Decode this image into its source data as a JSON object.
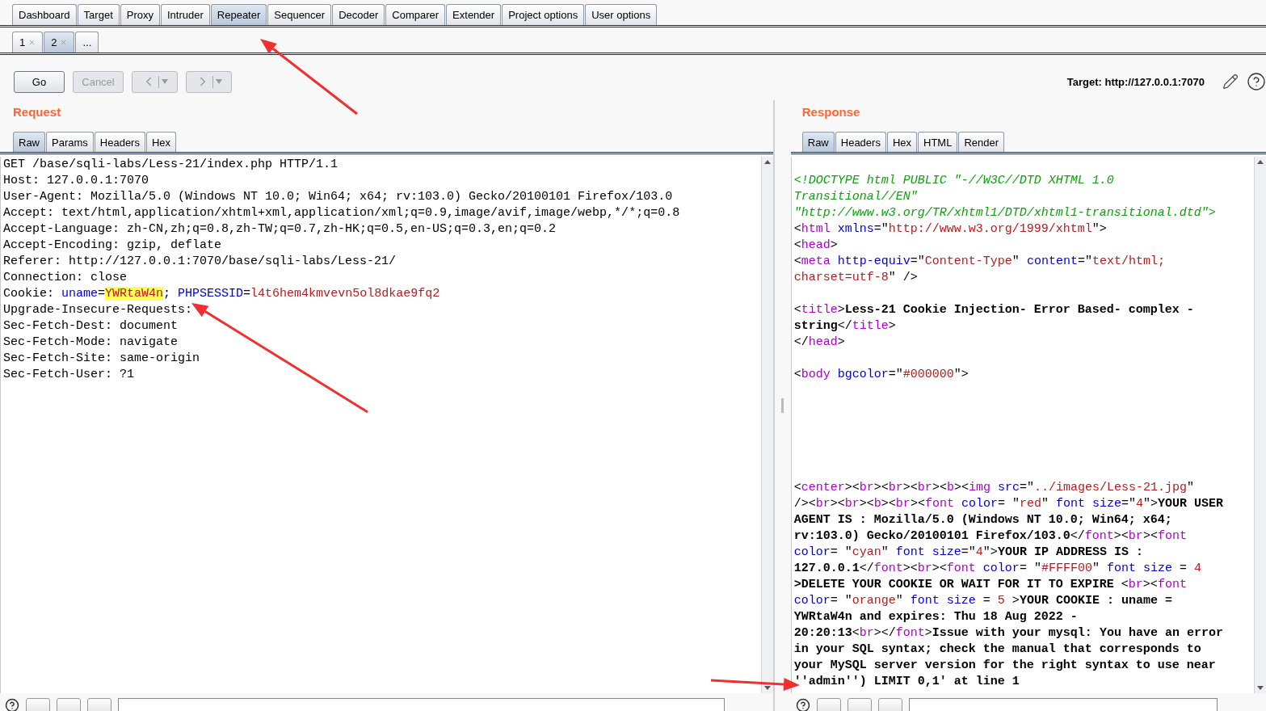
{
  "main_tabs": [
    {
      "label": "Dashboard",
      "selected": false
    },
    {
      "label": "Target",
      "selected": false
    },
    {
      "label": "Proxy",
      "selected": false
    },
    {
      "label": "Intruder",
      "selected": false
    },
    {
      "label": "Repeater",
      "selected": true
    },
    {
      "label": "Sequencer",
      "selected": false
    },
    {
      "label": "Decoder",
      "selected": false
    },
    {
      "label": "Comparer",
      "selected": false
    },
    {
      "label": "Extender",
      "selected": false
    },
    {
      "label": "Project options",
      "selected": false
    },
    {
      "label": "User options",
      "selected": false
    }
  ],
  "repeater_tabs": [
    {
      "label": "1",
      "closable": true,
      "selected": false
    },
    {
      "label": "2",
      "closable": true,
      "selected": true
    },
    {
      "label": "...",
      "closable": false,
      "selected": false
    }
  ],
  "toolbar": {
    "buttons": [
      {
        "kind": "text",
        "label": "Go",
        "disabled": false
      },
      {
        "kind": "text",
        "label": "Cancel",
        "disabled": true
      },
      {
        "kind": "back",
        "disabled": true
      },
      {
        "kind": "forward",
        "disabled": true
      }
    ],
    "target": "Target: http://127.0.0.1:7070"
  },
  "request": {
    "title": "Request",
    "tabs": [
      {
        "label": "Raw",
        "selected": true
      },
      {
        "label": "Params",
        "selected": false
      },
      {
        "label": "Headers",
        "selected": false
      },
      {
        "label": "Hex",
        "selected": false
      }
    ],
    "lines": [
      {
        "kind": "code",
        "spans": [
          {
            "kind": "plain",
            "text": "GET /base/sqli-labs/Less-21/index.php HTTP/1.1"
          }
        ]
      },
      {
        "kind": "code",
        "spans": [
          {
            "kind": "plain",
            "text": "Host: 127.0.0.1:7070"
          }
        ]
      },
      {
        "kind": "code",
        "spans": [
          {
            "kind": "plain",
            "text": "User-Agent: Mozilla/5.0 (Windows NT 10.0; Win64; x64; rv:103.0) Gecko/20100101 Firefox/103.0"
          }
        ]
      },
      {
        "kind": "code",
        "spans": [
          {
            "kind": "plain",
            "text": "Accept: text/html,application/xhtml+xml,application/xml;q=0.9,image/avif,image/webp,*/*;q=0.8"
          }
        ]
      },
      {
        "kind": "code",
        "spans": [
          {
            "kind": "plain",
            "text": "Accept-Language: zh-CN,zh;q=0.8,zh-TW;q=0.7,zh-HK;q=0.5,en-US;q=0.3,en;q=0.2"
          }
        ]
      },
      {
        "kind": "code",
        "spans": [
          {
            "kind": "plain",
            "text": "Accept-Encoding: gzip, deflate"
          }
        ]
      },
      {
        "kind": "code",
        "spans": [
          {
            "kind": "plain",
            "text": "Referer: http://127.0.0.1:7070/base/sqli-labs/Less-21/"
          }
        ]
      },
      {
        "kind": "code",
        "spans": [
          {
            "kind": "plain",
            "text": "Connection: close"
          }
        ]
      },
      {
        "kind": "code",
        "spans": [
          {
            "kind": "plain",
            "text": "Cookie: "
          },
          {
            "kind": "attr",
            "text": "uname"
          },
          {
            "kind": "plain",
            "text": "="
          },
          {
            "kind": "highlight",
            "text": "YWRtaW4n"
          },
          {
            "kind": "plain",
            "text": "; "
          },
          {
            "kind": "attr",
            "text": "PHPSESSID"
          },
          {
            "kind": "plain",
            "text": "="
          },
          {
            "kind": "val",
            "text": "l4t6hem4kmvevn5ol8dkae9fq2"
          }
        ]
      },
      {
        "kind": "code",
        "spans": [
          {
            "kind": "plain",
            "text": "Upgrade-Insecure-Requests:"
          }
        ]
      },
      {
        "kind": "code",
        "spans": [
          {
            "kind": "plain",
            "text": "Sec-Fetch-Dest: document"
          }
        ]
      },
      {
        "kind": "code",
        "spans": [
          {
            "kind": "plain",
            "text": "Sec-Fetch-Mode: navigate"
          }
        ]
      },
      {
        "kind": "code",
        "spans": [
          {
            "kind": "plain",
            "text": "Sec-Fetch-Site: same-origin"
          }
        ]
      },
      {
        "kind": "code",
        "spans": [
          {
            "kind": "plain",
            "text": "Sec-Fetch-User: ?1"
          }
        ]
      }
    ]
  },
  "response": {
    "title": "Response",
    "tabs": [
      {
        "label": "Raw",
        "selected": true
      },
      {
        "label": "Headers",
        "selected": false
      },
      {
        "label": "Hex",
        "selected": false
      },
      {
        "label": "HTML",
        "selected": false
      },
      {
        "label": "Render",
        "selected": false
      }
    ],
    "lines": [
      {
        "kind": "code",
        "spans": [
          {
            "kind": "comment",
            "text": "<!DOCTYPE html PUBLIC \"-//W3C//DTD XHTML 1.0"
          }
        ]
      },
      {
        "kind": "code",
        "spans": [
          {
            "kind": "comment",
            "text": "Transitional//EN\""
          }
        ]
      },
      {
        "kind": "code",
        "spans": [
          {
            "kind": "comment",
            "text": "\"http://www.w3.org/TR/xhtml1/DTD/xhtml1-transitional.dtd\">"
          }
        ]
      },
      {
        "kind": "code",
        "spans": [
          {
            "kind": "plain",
            "text": "<"
          },
          {
            "kind": "tag",
            "text": "html"
          },
          {
            "kind": "attr",
            "text": " xmlns"
          },
          {
            "kind": "plain",
            "text": "=\""
          },
          {
            "kind": "val",
            "text": "http://www.w3.org/1999/xhtml"
          },
          {
            "kind": "plain",
            "text": "\">"
          }
        ]
      },
      {
        "kind": "code",
        "spans": [
          {
            "kind": "plain",
            "text": "<"
          },
          {
            "kind": "tag",
            "text": "head"
          },
          {
            "kind": "plain",
            "text": ">"
          }
        ]
      },
      {
        "kind": "code",
        "spans": [
          {
            "kind": "plain",
            "text": "<"
          },
          {
            "kind": "tag",
            "text": "meta"
          },
          {
            "kind": "attr",
            "text": " http-equiv"
          },
          {
            "kind": "plain",
            "text": "=\""
          },
          {
            "kind": "val",
            "text": "Content-Type"
          },
          {
            "kind": "plain",
            "text": "\" "
          },
          {
            "kind": "attr",
            "text": "content"
          },
          {
            "kind": "plain",
            "text": "=\""
          },
          {
            "kind": "val",
            "text": "text/html;"
          }
        ]
      },
      {
        "kind": "code",
        "spans": [
          {
            "kind": "val",
            "text": "charset=utf-8"
          },
          {
            "kind": "plain",
            "text": "\" />"
          }
        ]
      },
      {
        "kind": "blank"
      },
      {
        "kind": "code",
        "spans": [
          {
            "kind": "plain",
            "text": "<"
          },
          {
            "kind": "tag",
            "text": "title"
          },
          {
            "kind": "plain",
            "text": ">"
          },
          {
            "kind": "bold",
            "text": "Less-21 Cookie Injection- Error Based- complex -"
          }
        ]
      },
      {
        "kind": "code",
        "spans": [
          {
            "kind": "bold",
            "text": "string"
          },
          {
            "kind": "plain",
            "text": "</"
          },
          {
            "kind": "tag",
            "text": "title"
          },
          {
            "kind": "plain",
            "text": ">"
          }
        ]
      },
      {
        "kind": "code",
        "spans": [
          {
            "kind": "plain",
            "text": "</"
          },
          {
            "kind": "tag",
            "text": "head"
          },
          {
            "kind": "plain",
            "text": ">"
          }
        ]
      },
      {
        "kind": "blank"
      },
      {
        "kind": "code",
        "spans": [
          {
            "kind": "plain",
            "text": "<"
          },
          {
            "kind": "tag",
            "text": "body"
          },
          {
            "kind": "attr",
            "text": " bgcolor"
          },
          {
            "kind": "plain",
            "text": "=\""
          },
          {
            "kind": "val",
            "text": "#000000"
          },
          {
            "kind": "plain",
            "text": "\">"
          }
        ]
      },
      {
        "kind": "blank"
      },
      {
        "kind": "blank"
      },
      {
        "kind": "blank"
      },
      {
        "kind": "blank"
      },
      {
        "kind": "blank"
      },
      {
        "kind": "blank"
      },
      {
        "kind": "code",
        "spans": [
          {
            "kind": "plain",
            "text": "<"
          },
          {
            "kind": "tag",
            "text": "center"
          },
          {
            "kind": "plain",
            "text": "><"
          },
          {
            "kind": "tag",
            "text": "br"
          },
          {
            "kind": "plain",
            "text": "><"
          },
          {
            "kind": "tag",
            "text": "br"
          },
          {
            "kind": "plain",
            "text": "><"
          },
          {
            "kind": "tag",
            "text": "br"
          },
          {
            "kind": "plain",
            "text": "><"
          },
          {
            "kind": "tag",
            "text": "b"
          },
          {
            "kind": "plain",
            "text": "><"
          },
          {
            "kind": "tag",
            "text": "img"
          },
          {
            "kind": "attr",
            "text": " src"
          },
          {
            "kind": "plain",
            "text": "=\""
          },
          {
            "kind": "val",
            "text": "../images/Less-21.jpg"
          },
          {
            "kind": "plain",
            "text": "\""
          }
        ]
      },
      {
        "kind": "code",
        "spans": [
          {
            "kind": "plain",
            "text": "/><"
          },
          {
            "kind": "tag",
            "text": "br"
          },
          {
            "kind": "plain",
            "text": "><"
          },
          {
            "kind": "tag",
            "text": "br"
          },
          {
            "kind": "plain",
            "text": "><"
          },
          {
            "kind": "tag",
            "text": "b"
          },
          {
            "kind": "plain",
            "text": "><"
          },
          {
            "kind": "tag",
            "text": "br"
          },
          {
            "kind": "plain",
            "text": "><"
          },
          {
            "kind": "tag",
            "text": "font"
          },
          {
            "kind": "attr",
            "text": " color"
          },
          {
            "kind": "plain",
            "text": "= \""
          },
          {
            "kind": "val",
            "text": "red"
          },
          {
            "kind": "plain",
            "text": "\" "
          },
          {
            "kind": "attr",
            "text": "font size"
          },
          {
            "kind": "plain",
            "text": "=\""
          },
          {
            "kind": "val",
            "text": "4"
          },
          {
            "kind": "plain",
            "text": "\">"
          },
          {
            "kind": "bold",
            "text": "YOUR USER"
          }
        ]
      },
      {
        "kind": "code",
        "spans": [
          {
            "kind": "bold",
            "text": "AGENT IS : Mozilla/5.0 (Windows NT 10.0; Win64; x64;"
          }
        ]
      },
      {
        "kind": "code",
        "spans": [
          {
            "kind": "bold",
            "text": "rv:103.0) Gecko/20100101 Firefox/103.0"
          },
          {
            "kind": "plain",
            "text": "</"
          },
          {
            "kind": "tag",
            "text": "font"
          },
          {
            "kind": "plain",
            "text": "><"
          },
          {
            "kind": "tag",
            "text": "br"
          },
          {
            "kind": "plain",
            "text": "><"
          },
          {
            "kind": "tag",
            "text": "font"
          }
        ]
      },
      {
        "kind": "code",
        "spans": [
          {
            "kind": "attr",
            "text": "color"
          },
          {
            "kind": "plain",
            "text": "= \""
          },
          {
            "kind": "val",
            "text": "cyan"
          },
          {
            "kind": "plain",
            "text": "\" "
          },
          {
            "kind": "attr",
            "text": "font size"
          },
          {
            "kind": "plain",
            "text": "=\""
          },
          {
            "kind": "val",
            "text": "4"
          },
          {
            "kind": "plain",
            "text": "\">"
          },
          {
            "kind": "bold",
            "text": "YOUR IP ADDRESS IS :"
          }
        ]
      },
      {
        "kind": "code",
        "spans": [
          {
            "kind": "bold",
            "text": "127.0.0.1"
          },
          {
            "kind": "plain",
            "text": "</"
          },
          {
            "kind": "tag",
            "text": "font"
          },
          {
            "kind": "plain",
            "text": "><"
          },
          {
            "kind": "tag",
            "text": "br"
          },
          {
            "kind": "plain",
            "text": "><"
          },
          {
            "kind": "tag",
            "text": "font"
          },
          {
            "kind": "attr",
            "text": " color"
          },
          {
            "kind": "plain",
            "text": "= \""
          },
          {
            "kind": "val",
            "text": "#FFFF00"
          },
          {
            "kind": "plain",
            "text": "\" "
          },
          {
            "kind": "attr",
            "text": "font size"
          },
          {
            "kind": "plain",
            "text": " = "
          },
          {
            "kind": "val",
            "text": "4"
          }
        ]
      },
      {
        "kind": "code",
        "spans": [
          {
            "kind": "bold",
            "text": ">DELETE YOUR COOKIE OR WAIT FOR IT TO EXPIRE "
          },
          {
            "kind": "plain",
            "text": "<"
          },
          {
            "kind": "tag",
            "text": "br"
          },
          {
            "kind": "plain",
            "text": "><"
          },
          {
            "kind": "tag",
            "text": "font"
          }
        ]
      },
      {
        "kind": "code",
        "spans": [
          {
            "kind": "attr",
            "text": "color"
          },
          {
            "kind": "plain",
            "text": "= \""
          },
          {
            "kind": "val",
            "text": "orange"
          },
          {
            "kind": "plain",
            "text": "\" "
          },
          {
            "kind": "attr",
            "text": "font size"
          },
          {
            "kind": "plain",
            "text": " = "
          },
          {
            "kind": "val",
            "text": "5"
          },
          {
            "kind": "plain",
            "text": " >"
          },
          {
            "kind": "bold",
            "text": "YOUR COOKIE : uname ="
          }
        ]
      },
      {
        "kind": "code",
        "spans": [
          {
            "kind": "bold",
            "text": "YWRtaW4n and expires: Thu 18 Aug 2022 -"
          }
        ]
      },
      {
        "kind": "code",
        "spans": [
          {
            "kind": "bold",
            "text": "20:20:13"
          },
          {
            "kind": "plain",
            "text": "<"
          },
          {
            "kind": "tag",
            "text": "br"
          },
          {
            "kind": "plain",
            "text": "></"
          },
          {
            "kind": "tag",
            "text": "font"
          },
          {
            "kind": "plain",
            "text": ">"
          },
          {
            "kind": "bold",
            "text": "Issue with your mysql: You have an error"
          }
        ]
      },
      {
        "kind": "code",
        "spans": [
          {
            "kind": "bold",
            "text": "in your SQL syntax; check the manual that corresponds to"
          }
        ]
      },
      {
        "kind": "code",
        "spans": [
          {
            "kind": "bold",
            "text": "your MySQL server version for the right syntax to use near"
          }
        ]
      },
      {
        "kind": "code",
        "spans": [
          {
            "kind": "bold",
            "text": "''admin'') LIMIT 0,1' at line 1"
          }
        ]
      }
    ]
  }
}
